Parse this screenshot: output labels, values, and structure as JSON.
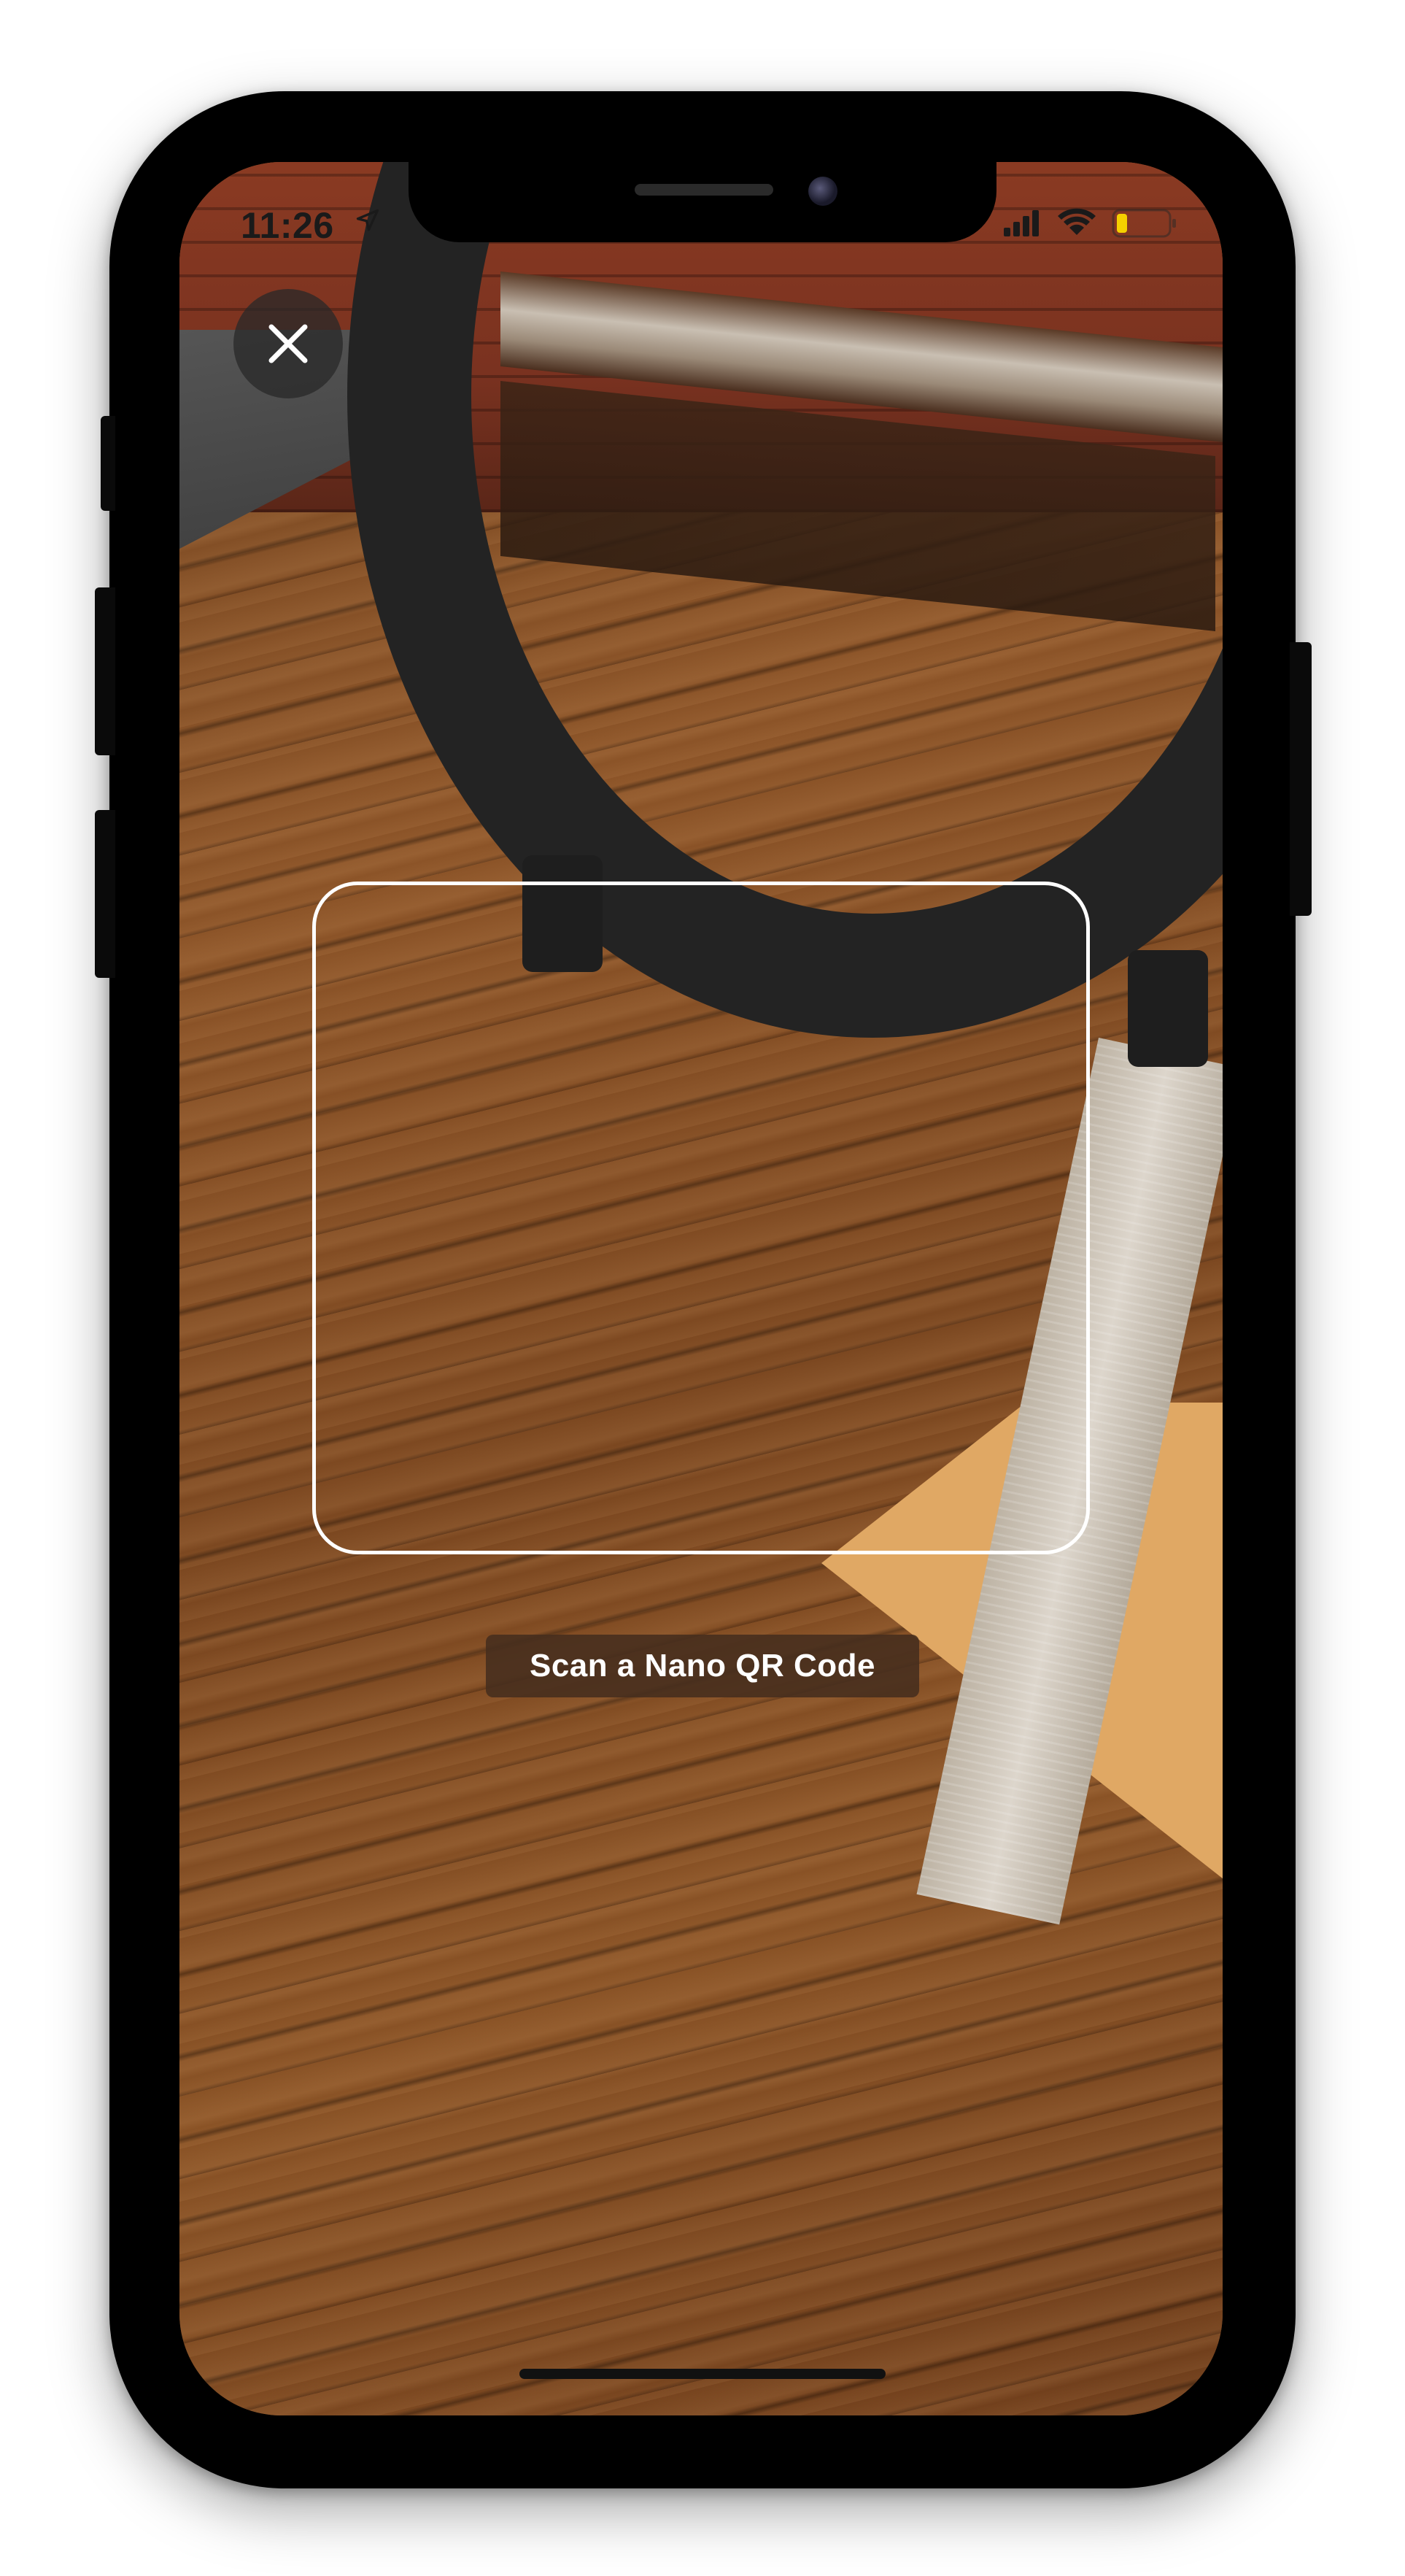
{
  "status_bar": {
    "time": "11:26",
    "location_icon": "location-arrow-icon",
    "signal_icon": "cellular-signal-icon",
    "wifi_icon": "wifi-icon",
    "battery_icon": "battery-icon",
    "battery_color": "#f5d000",
    "camera_indicator_color": "#2bd158"
  },
  "close_button": {
    "icon": "close-icon"
  },
  "scanner": {
    "instruction": "Scan a Nano QR Code"
  },
  "colors": {
    "frame": "#ffffff",
    "label_background": "#462d1e",
    "label_text": "#ffffff"
  }
}
